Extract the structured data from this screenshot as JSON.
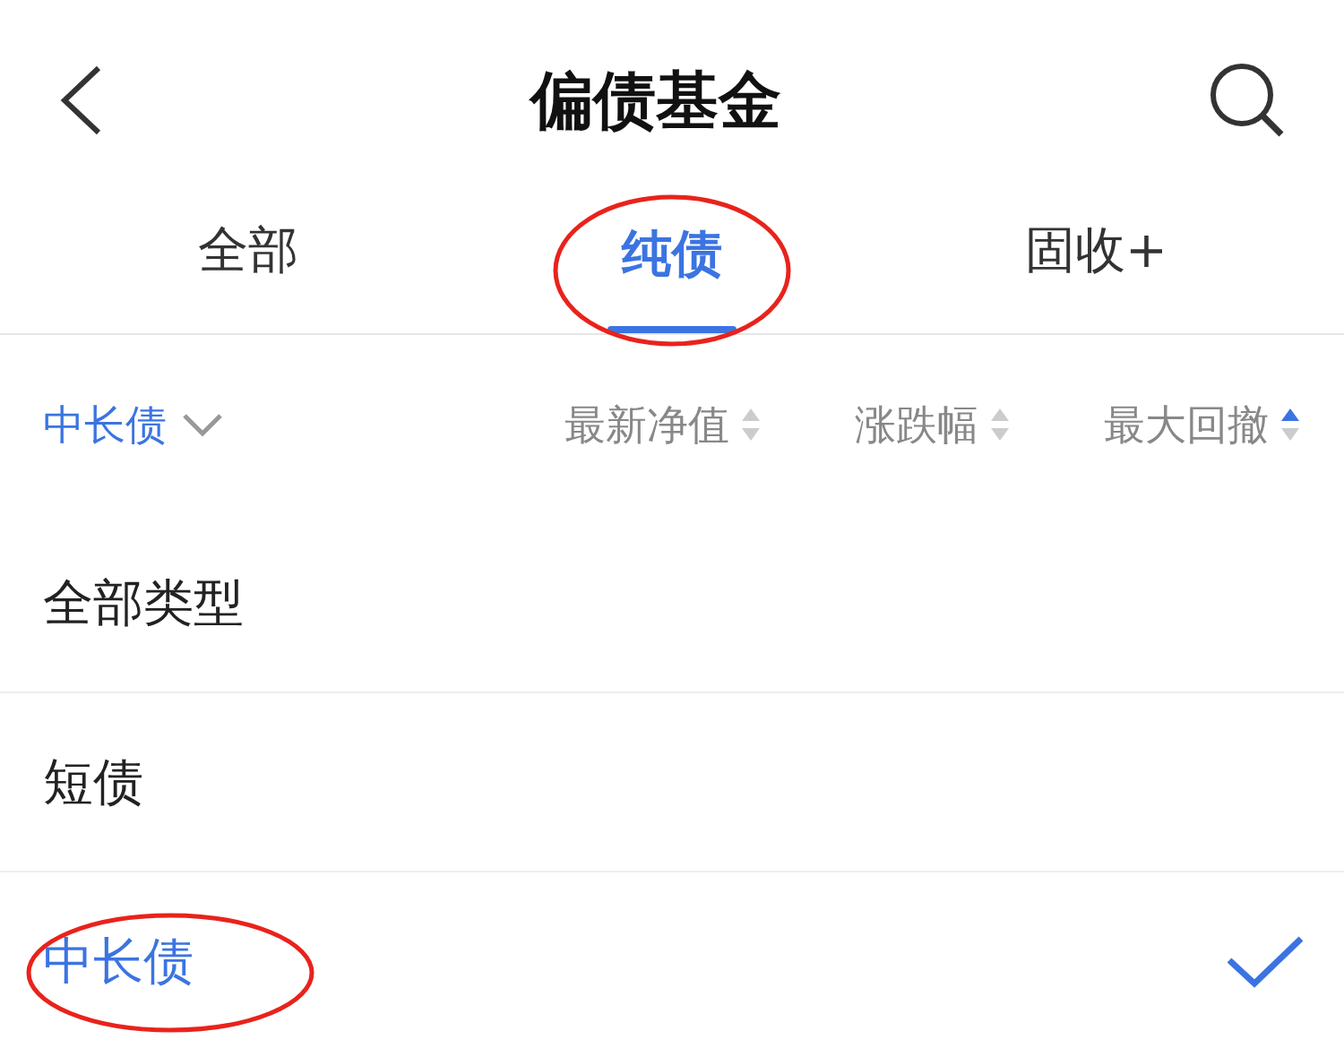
{
  "header": {
    "title": "偏债基金"
  },
  "tabs": [
    {
      "label": "全部",
      "selected": false,
      "circled": false
    },
    {
      "label": "纯债",
      "selected": true,
      "circled": true
    },
    {
      "label": "固收+",
      "selected": false,
      "circled": false
    }
  ],
  "filter": {
    "label": "中长债",
    "expanded": true
  },
  "columns": [
    {
      "label": "最新净值",
      "sorted_ascending": false
    },
    {
      "label": "涨跌幅",
      "sorted_ascending": false
    },
    {
      "label": "最大回撤",
      "sorted_ascending": true
    }
  ],
  "options": [
    {
      "label": "全部类型",
      "selected": false,
      "circled": false
    },
    {
      "label": "短债",
      "selected": false,
      "circled": false
    },
    {
      "label": "中长债",
      "selected": true,
      "circled": true
    }
  ]
}
